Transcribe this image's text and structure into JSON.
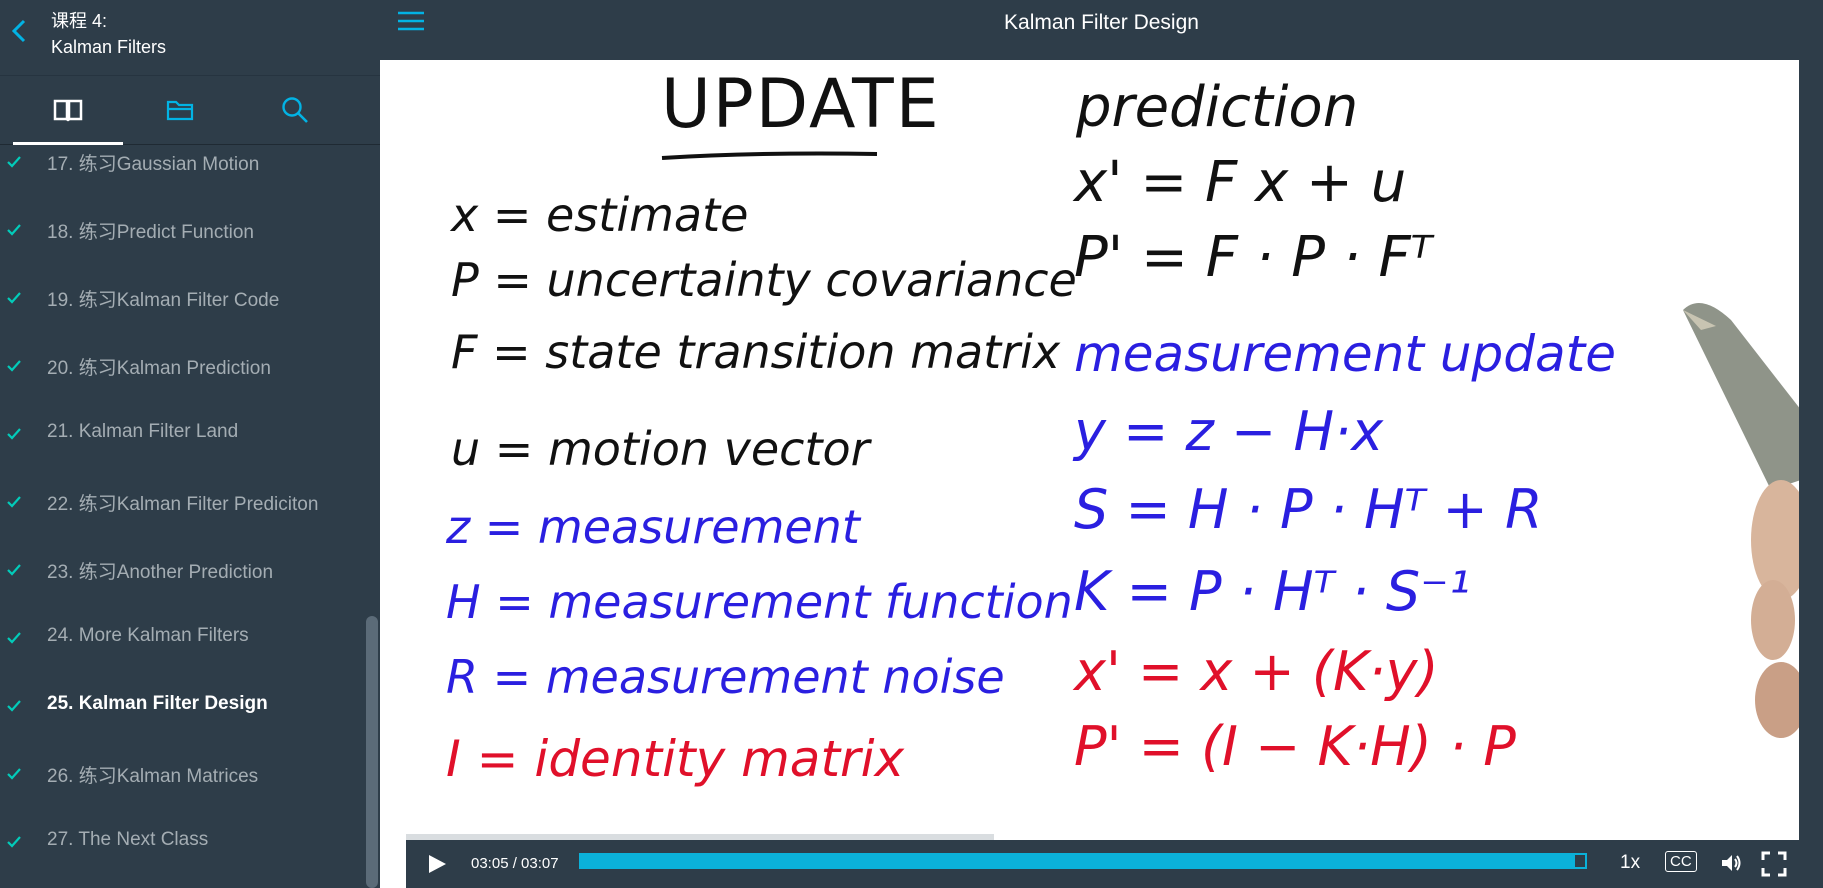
{
  "sidebar": {
    "course": {
      "line1": "课程 4:",
      "line2": "Kalman Filters"
    },
    "items": [
      {
        "label": "17. 练习Gaussian Motion"
      },
      {
        "label": "18. 练习Predict Function"
      },
      {
        "label": "19. 练习Kalman Filter Code"
      },
      {
        "label": "20. 练习Kalman Prediction"
      },
      {
        "label": "21. Kalman Filter Land"
      },
      {
        "label": "22. 练习Kalman Filter Prediciton"
      },
      {
        "label": "23. 练习Another Prediction"
      },
      {
        "label": "24. More Kalman Filters"
      },
      {
        "label": "25. Kalman Filter Design"
      },
      {
        "label": "26. 练习Kalman Matrices"
      },
      {
        "label": "27. The Next Class"
      }
    ],
    "current_item": "25. Kalman Filter Design"
  },
  "topbar": {
    "title": "Kalman Filter Design"
  },
  "board": {
    "left_title": "UPDATE",
    "left": [
      {
        "text": "x = estimate",
        "color": "black"
      },
      {
        "text": "P = uncertainty covariance",
        "color": "black"
      },
      {
        "text": "F = state transition matrix",
        "color": "black"
      },
      {
        "text": "u = motion vector",
        "color": "black"
      },
      {
        "text": "z = measurement",
        "color": "blue"
      },
      {
        "text": "H = measurement function",
        "color": "blue"
      },
      {
        "text": "R = measurement noise",
        "color": "blue"
      },
      {
        "text": "I = identity matrix",
        "color": "red"
      }
    ],
    "right_title": "prediction",
    "prediction": [
      "x' = F x + u",
      "P' = F · P · Fᵀ"
    ],
    "update_title": "measurement update",
    "update_blue": [
      "y = z − H·x",
      "S = H · P · Hᵀ + R",
      "K = P · Hᵀ · S⁻¹"
    ],
    "update_red": [
      "x' = x + (K·y)",
      "P' = (I − K·H) · P"
    ]
  },
  "player": {
    "time": "03:05 / 03:07",
    "progress": 0.99,
    "speed": "1x",
    "cc": "CC"
  },
  "colors": {
    "accent": "#02b3e4",
    "panel": "#2e3d49",
    "check": "#02ccba"
  }
}
